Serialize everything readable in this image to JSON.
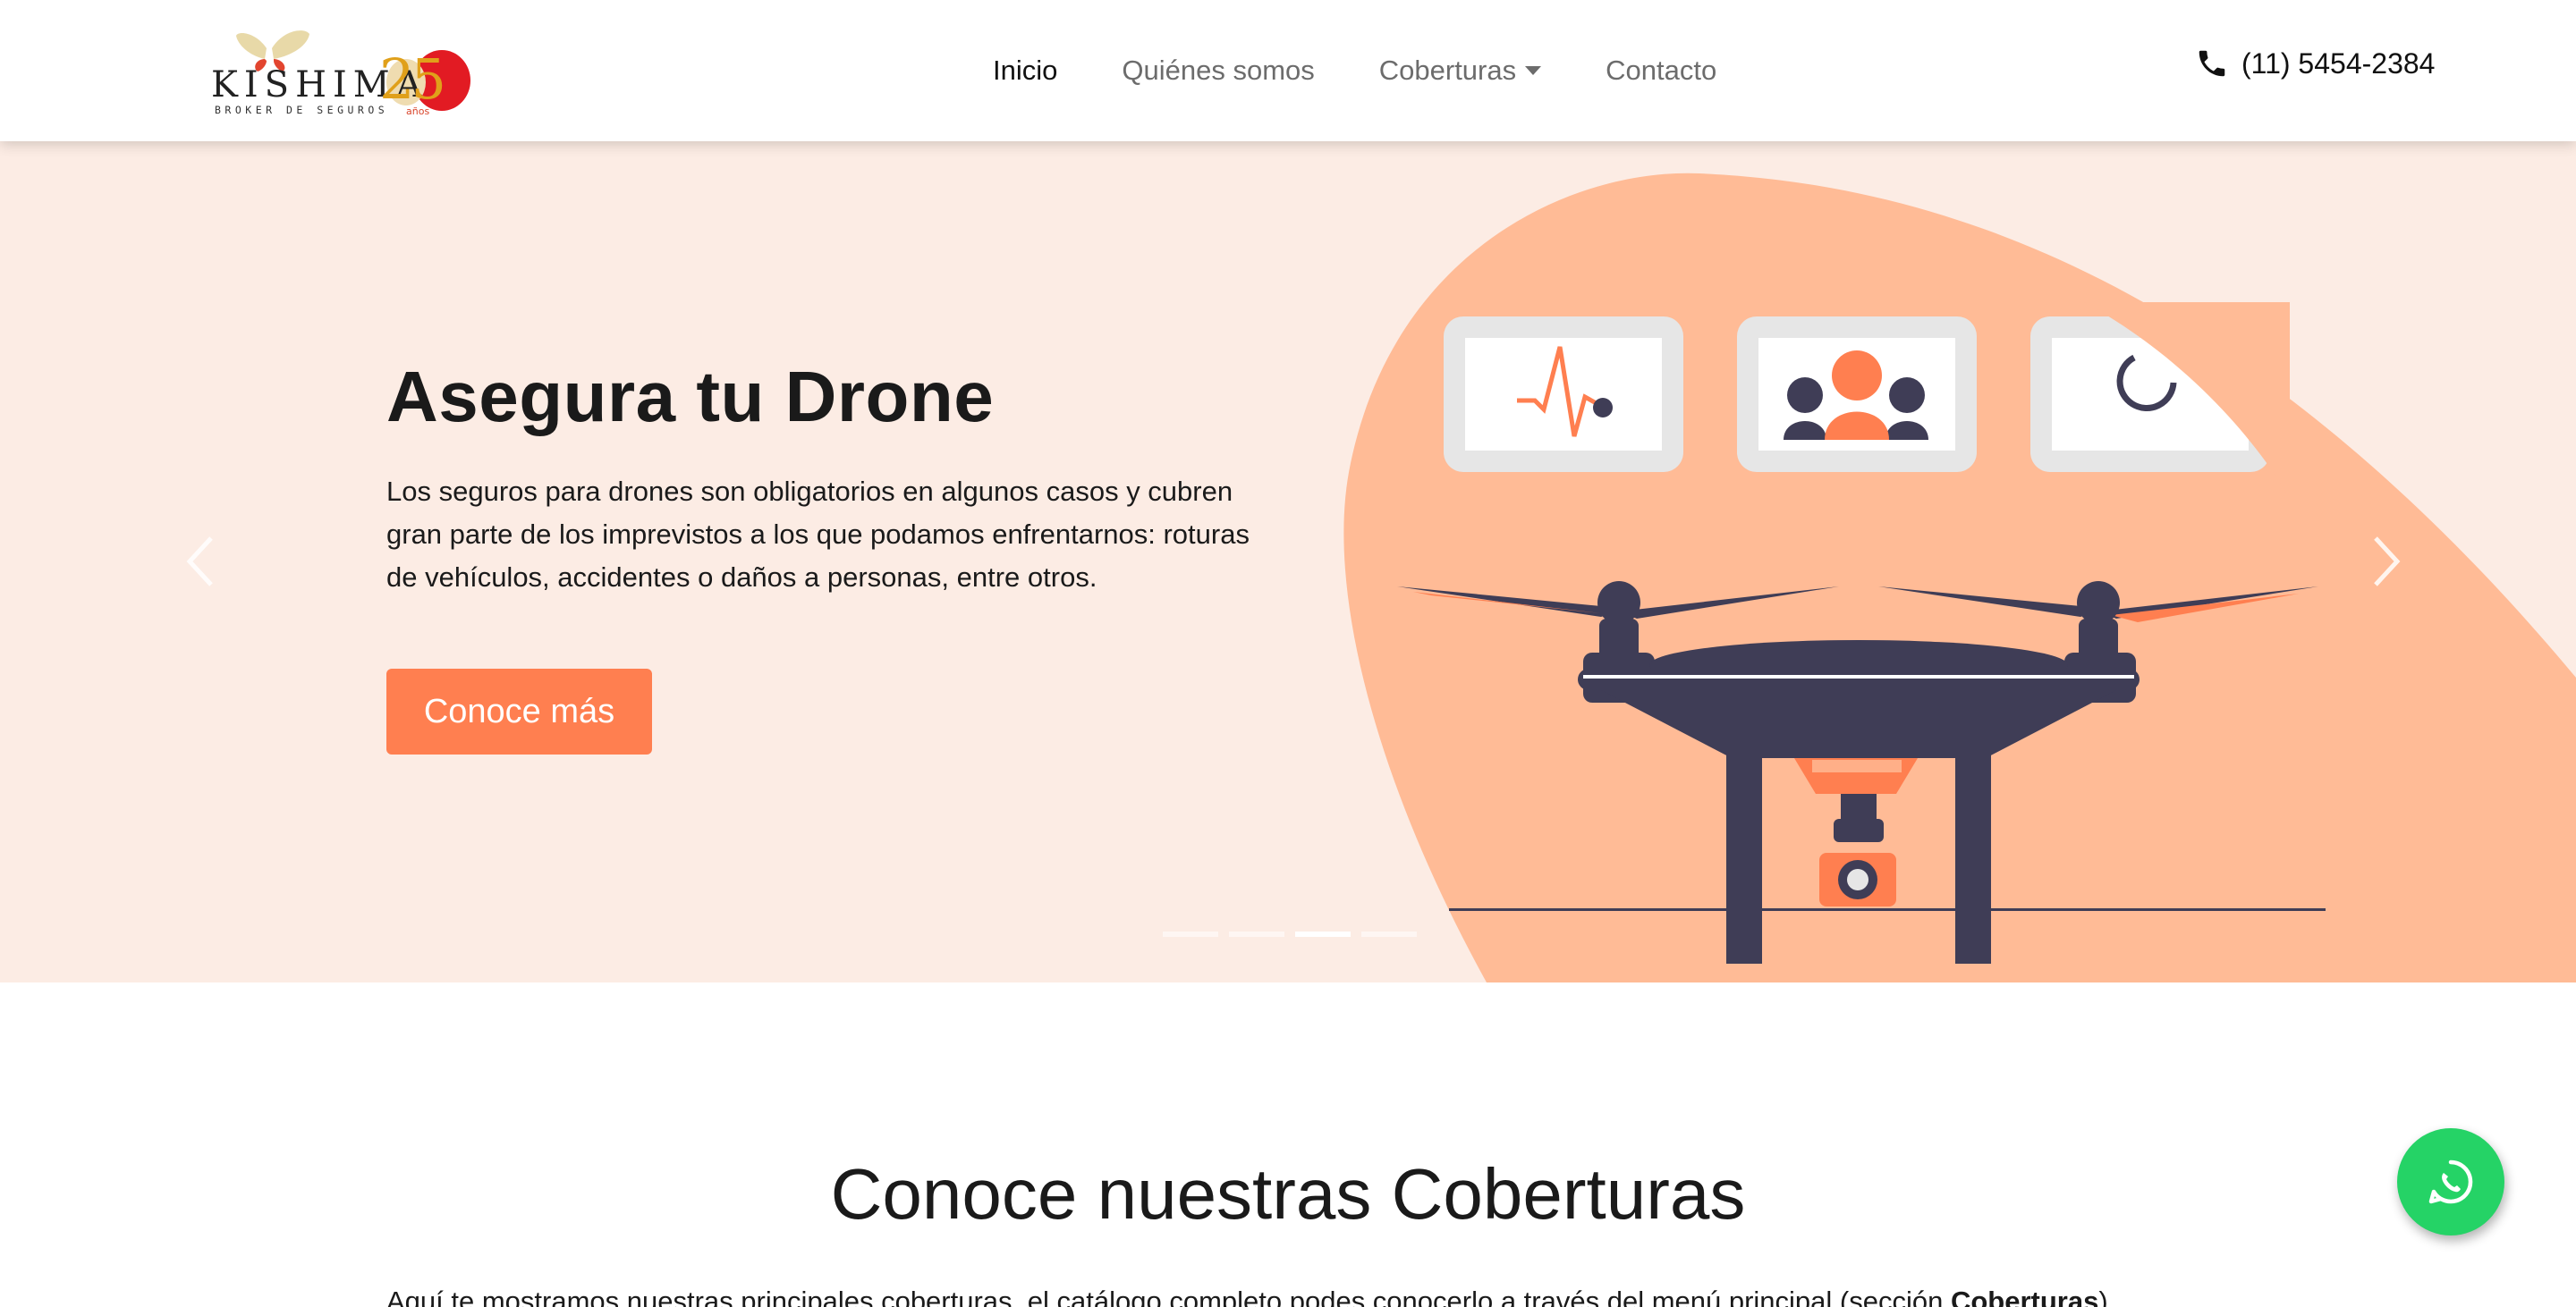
{
  "brand": {
    "name": "KISHIMA",
    "subtitle": "BROKER DE SEGUROS",
    "anniversary": "25",
    "anniversary_label": "años"
  },
  "nav": {
    "items": [
      {
        "label": "Inicio",
        "active": true
      },
      {
        "label": "Quiénes somos",
        "active": false
      },
      {
        "label": "Coberturas",
        "active": false,
        "dropdown": true
      },
      {
        "label": "Contacto",
        "active": false
      }
    ],
    "phone": "(11) 5454-2384",
    "phone_icon": "phone-icon"
  },
  "hero": {
    "title": "Asegura tu Drone",
    "text": "Los seguros para drones son obligatorios en algunos casos y cubren gran parte de los imprevistos a los que podamos enfrentarnos: roturas de vehículos, accidentes o daños a personas, entre otros.",
    "button": "Conoce más",
    "slide_count": 4,
    "active_slide": 3
  },
  "coverage": {
    "title": "Conoce nuestras Coberturas",
    "text_before": "Aquí te mostramos nuestras principales coberturas, el catálogo completo podes conocerlo a través del menú principal (sección ",
    "text_bold": "Coberturas",
    "text_after": ")."
  },
  "colors": {
    "accent": "#ff7f50",
    "hero_bg": "#fcece4",
    "blob": "#ffbb96",
    "drone": "#3f3d56",
    "whatsapp": "#25d366"
  }
}
